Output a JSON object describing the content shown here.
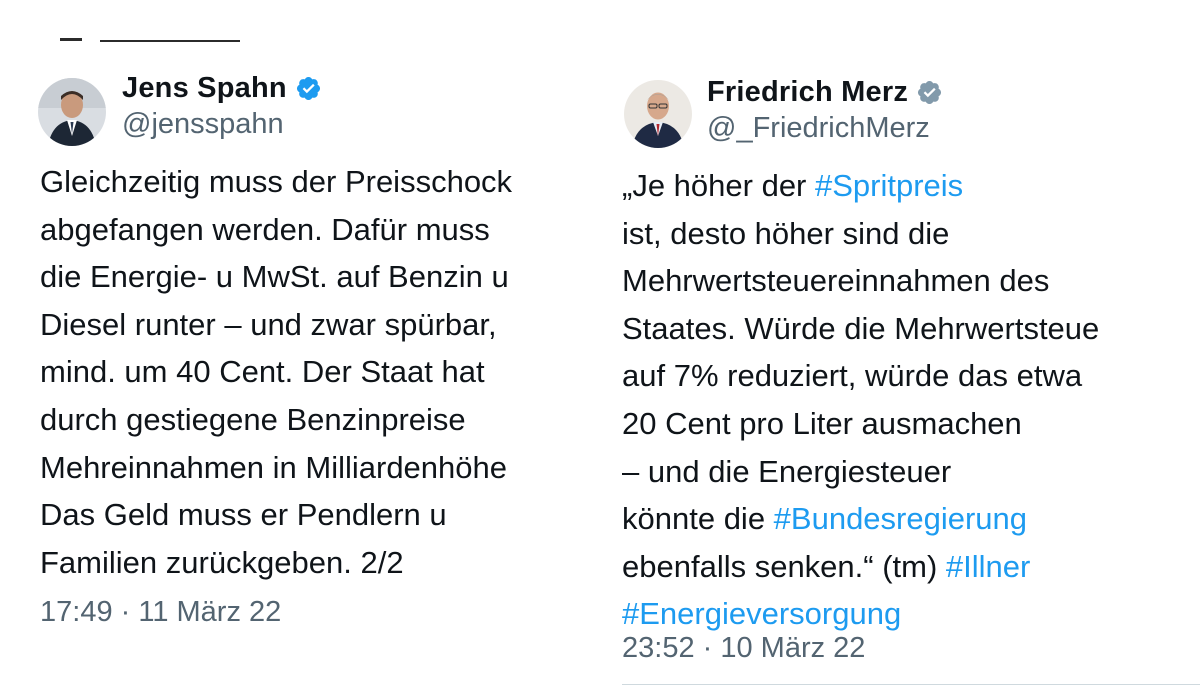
{
  "tweets": [
    {
      "display_name": "Jens Spahn",
      "handle": "@jensspahn",
      "verified_icon": "verified-badge-icon",
      "verified_color": "#1d9bf0",
      "text_lines": [
        [
          {
            "t": "Gleichzeitig muss der Preisschock"
          }
        ],
        [
          {
            "t": "abgefangen werden. Dafür muss"
          }
        ],
        [
          {
            "t": "die Energie- u MwSt. auf Benzin u"
          }
        ],
        [
          {
            "t": "Diesel runter – und zwar spürbar,"
          }
        ],
        [
          {
            "t": "mind. um 40 Cent. Der Staat hat"
          }
        ],
        [
          {
            "t": "durch gestiegene Benzinpreise"
          }
        ],
        [
          {
            "t": "Mehreinnahmen in Milliardenhöhe"
          }
        ],
        [
          {
            "t": "Das Geld muss er Pendlern u"
          }
        ],
        [
          {
            "t": "Familien zurückgeben. 2/2"
          }
        ]
      ],
      "timestamp": "17:49 · 11 März 22"
    },
    {
      "display_name": "Friedrich Merz",
      "handle": "@_FriedrichMerz",
      "verified_icon": "verified-badge-icon",
      "verified_color": "#829aab",
      "text_lines": [
        [
          {
            "t": "„Je höher der "
          },
          {
            "t": "#Spritpreis",
            "tag": true
          }
        ],
        [
          {
            "t": "ist, desto höher sind die"
          }
        ],
        [
          {
            "t": "Mehrwertsteuereinnahmen des"
          }
        ],
        [
          {
            "t": "Staates. Würde die Mehrwertsteue"
          }
        ],
        [
          {
            "t": "auf 7% reduziert, würde das etwa"
          }
        ],
        [
          {
            "t": "20 Cent pro Liter ausmachen"
          }
        ],
        [
          {
            "t": "– und die Energiesteuer"
          }
        ],
        [
          {
            "t": "könnte die "
          },
          {
            "t": "#Bundesregierung",
            "tag": true
          }
        ],
        [
          {
            "t": "ebenfalls senken.“ (tm) "
          },
          {
            "t": "#Illner",
            "tag": true
          }
        ],
        [
          {
            "t": "#Energieversorgung",
            "tag": true
          }
        ]
      ],
      "timestamp": "23:52 · 10 März 22"
    }
  ],
  "colors": {
    "text": "#0f1419",
    "secondary": "#536471",
    "hashtag": "#1d9bf0",
    "divider": "#cfd9de"
  }
}
